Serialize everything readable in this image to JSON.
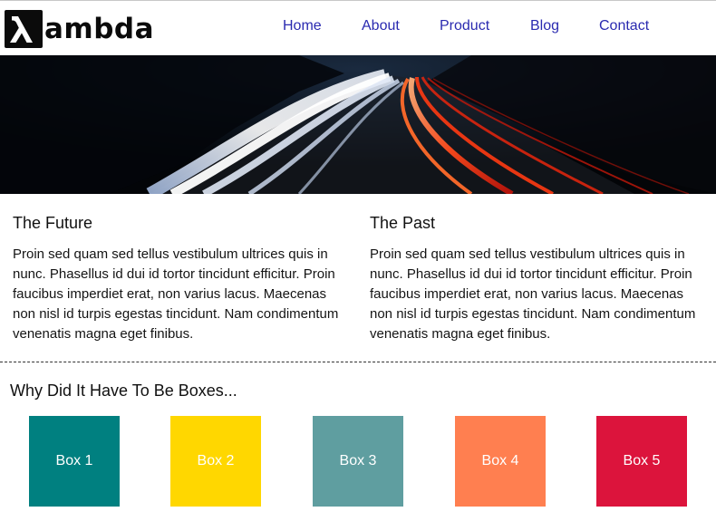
{
  "header": {
    "logo_text": "ambda",
    "logo_icon": "lambda-icon",
    "nav": [
      {
        "label": "Home"
      },
      {
        "label": "About"
      },
      {
        "label": "Product"
      },
      {
        "label": "Blog"
      },
      {
        "label": "Contact"
      }
    ]
  },
  "hero": {
    "image": "night-highway-light-trails"
  },
  "columns": [
    {
      "title": "The Future",
      "text": "Proin sed quam sed tellus vestibulum ultrices quis in nunc. Phasellus id dui id tortor tincidunt efficitur. Proin faucibus imperdiet erat, non varius lacus. Maecenas non nisl id turpis egestas tincidunt. Nam condimentum venenatis magna eget finibus."
    },
    {
      "title": "The Past",
      "text": "Proin sed quam sed tellus vestibulum ultrices quis in nunc. Phasellus id dui id tortor tincidunt efficitur. Proin faucibus imperdiet erat, non varius lacus. Maecenas non nisl id turpis egestas tincidunt. Nam condimentum venenatis magna eget finibus."
    }
  ],
  "boxes": {
    "title": "Why Did It Have To Be Boxes...",
    "items": [
      {
        "label": "Box 1",
        "color": "#008080"
      },
      {
        "label": "Box 2",
        "color": "#FFD700"
      },
      {
        "label": "Box 3",
        "color": "#5F9EA0"
      },
      {
        "label": "Box 4",
        "color": "#FF7F50"
      },
      {
        "label": "Box 5",
        "color": "#DC143C"
      }
    ]
  },
  "colors": {
    "nav_link": "#2a2ab0",
    "logo": "#0b0b0b"
  }
}
